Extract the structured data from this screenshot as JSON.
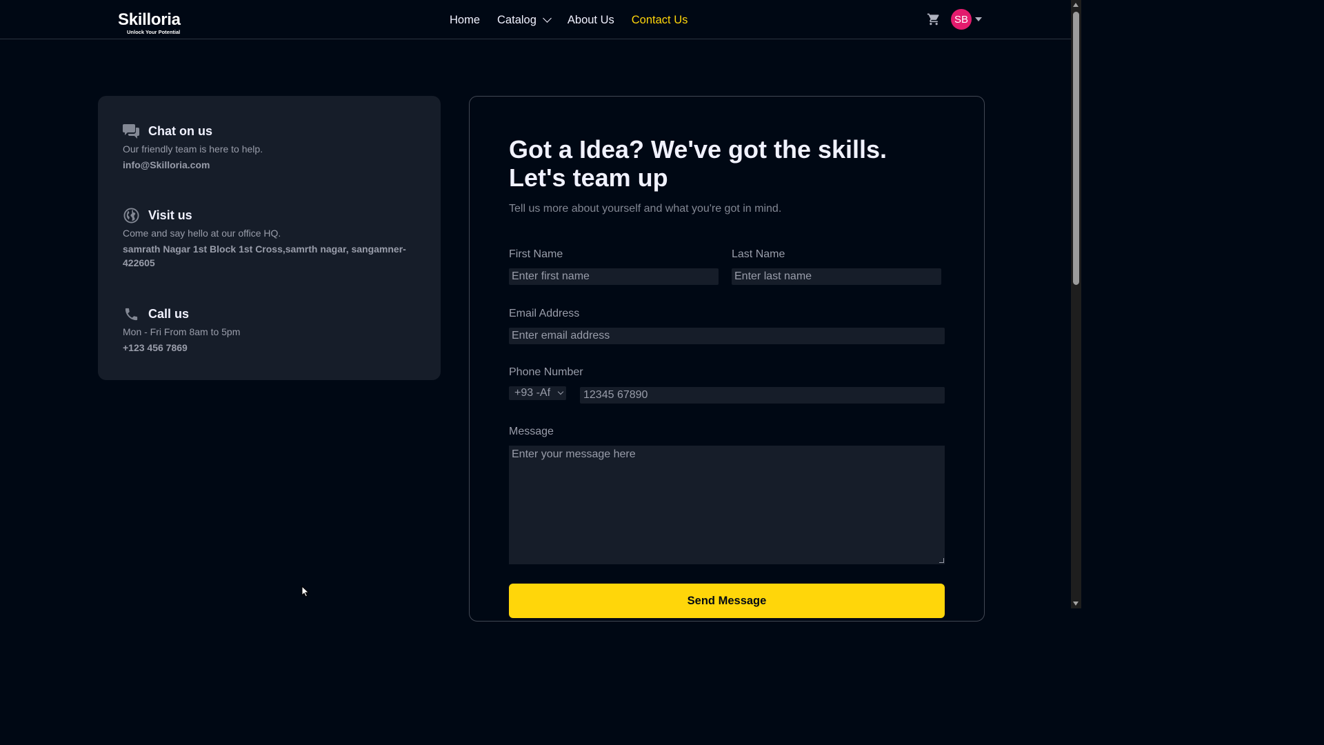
{
  "navbar": {
    "logo": {
      "name": "Skilloria",
      "tagline": "Unlock Your Potential"
    },
    "links": [
      {
        "label": "Home",
        "active": false
      },
      {
        "label": "Catalog",
        "active": false,
        "has_dropdown": true
      },
      {
        "label": "About Us",
        "active": false
      },
      {
        "label": "Contact Us",
        "active": true
      }
    ],
    "cart_icon": "cart-icon",
    "avatar_initials": "SB"
  },
  "contact_info": [
    {
      "icon": "chat-bubbles-icon",
      "title": "Chat on us",
      "description": "Our friendly team is here to help.",
      "detail": "info@Skilloria.com"
    },
    {
      "icon": "globe-icon",
      "title": "Visit us",
      "description": "Come and say hello at our office HQ.",
      "detail": "samrath Nagar 1st Block 1st Cross,samrth nagar, sangamner-422605"
    },
    {
      "icon": "phone-icon",
      "title": "Call us",
      "description": "Mon - Fri From 8am to 5pm",
      "detail": "+123 456 7869"
    }
  ],
  "form": {
    "title": "Got a Idea? We've got the skills. Let's team up",
    "subtitle": "Tell us more about yourself and what you're got in mind.",
    "first_name": {
      "label": "First Name",
      "placeholder": "Enter first name"
    },
    "last_name": {
      "label": "Last Name",
      "placeholder": "Enter last name"
    },
    "email": {
      "label": "Email Address",
      "placeholder": "Enter email address"
    },
    "phone": {
      "label": "Phone Number",
      "country_code": "+93 -Af",
      "placeholder": "12345 67890"
    },
    "message": {
      "label": "Message",
      "placeholder": "Enter your message here"
    },
    "submit_label": "Send Message"
  },
  "colors": {
    "background": "#000814",
    "card": "#161d29",
    "accent": "#ffd60a",
    "avatar": "#e31b6d"
  }
}
